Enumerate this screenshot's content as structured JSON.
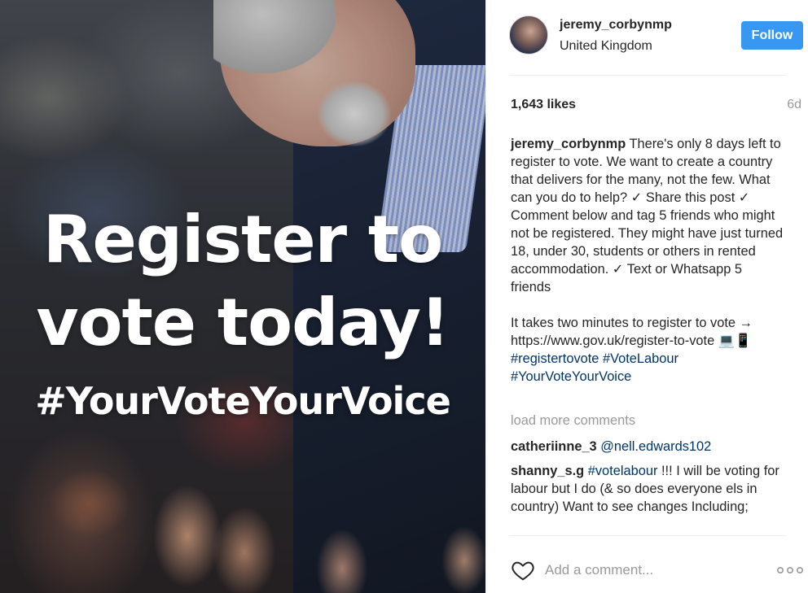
{
  "image": {
    "overlay_line1": "Register to",
    "overlay_line2": "vote today!",
    "overlay_hashtag": "#YourVoteYourVoice"
  },
  "header": {
    "username": "jeremy_corbynmp",
    "location": "United Kingdom",
    "follow_label": "Follow"
  },
  "stats": {
    "likes": "1,643 likes",
    "age": "6d"
  },
  "caption": {
    "username": "jeremy_corbynmp",
    "text_part1": "There's only 8 days left to register to vote. We want to create a country that delivers for the many, not the few. What can you do to help? ✓ Share this post ✓ Comment below and tag 5 friends who might not be registered. They might have just turned 18, under 30, students or others in rented accommodation. ✓ Text or Whatsapp 5 friends",
    "text_part2": "It takes two minutes to register to vote → https://www.gov.uk/register-to-vote 💻📱",
    "hashtag1": "#registertovote",
    "hashtag2": "#VoteLabour",
    "hashtag3": "#YourVoteYourVoice"
  },
  "load_more": "load more comments",
  "comments": [
    {
      "username": "catheriinne_3",
      "mention": "@nell.edwards102",
      "text": ""
    },
    {
      "username": "shanny_s.g",
      "hashtag": "#votelabour",
      "text": "!!! I will be voting for labour but I do (& so does everyone els in country) Want to see changes Including;"
    }
  ],
  "footer": {
    "comment_placeholder": "Add a comment...",
    "like_icon": "heart-icon",
    "options_icon": "more-options-icon"
  },
  "colors": {
    "follow_button": "#3897f0",
    "link": "#003569",
    "muted": "#999999",
    "text": "#262626"
  }
}
